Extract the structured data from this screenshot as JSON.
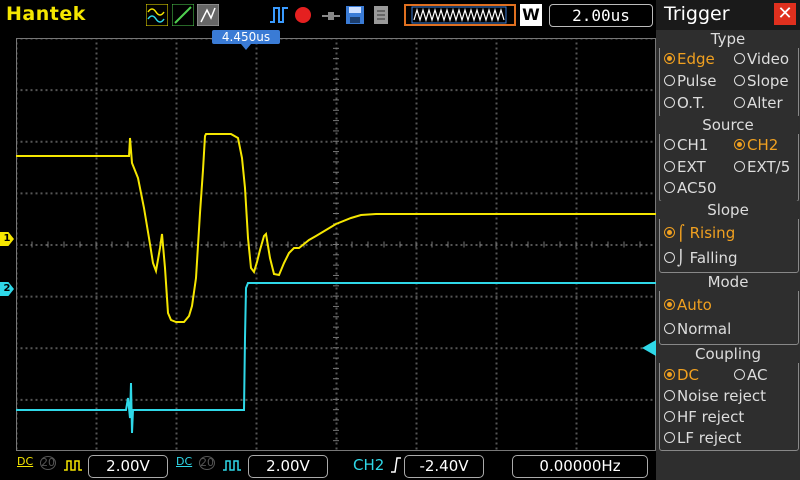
{
  "header": {
    "brand": "Hantek",
    "timebase": "2.00us",
    "trigger_position": "4.450us",
    "mode_letter": "W"
  },
  "icons": {
    "waveform_math": "wave-icon",
    "cursor": "line-icon",
    "run": "pulse-icon",
    "record": "record-icon",
    "save": "save-icon",
    "file": "document-icon"
  },
  "colors": {
    "ch1": "#f5e600",
    "ch2": "#2fd8e8",
    "selected": "#f0a020",
    "trig_pos": "#3a7bd5"
  },
  "trigger_panel": {
    "title": "Trigger",
    "type": {
      "label": "Type",
      "options": [
        "Edge",
        "Video",
        "Pulse",
        "Slope",
        "O.T.",
        "Alter"
      ],
      "selected": "Edge"
    },
    "source": {
      "label": "Source",
      "options": [
        "CH1",
        "CH2",
        "EXT",
        "EXT/5",
        "AC50"
      ],
      "selected": "CH2"
    },
    "slope": {
      "label": "Slope",
      "options": [
        "Rising",
        "Falling"
      ],
      "selected": "Rising"
    },
    "mode": {
      "label": "Mode",
      "options": [
        "Auto",
        "Normal"
      ],
      "selected": "Auto"
    },
    "coupling": {
      "label": "Coupling",
      "options": [
        "DC",
        "AC",
        "Noise reject",
        "HF reject",
        "LF reject"
      ],
      "selected": "DC"
    }
  },
  "markers": {
    "ch1": "1",
    "ch2": "2"
  },
  "status": {
    "ch1_coupling": "DC",
    "ch1_bw": "20",
    "ch1_volts": "2.00V",
    "ch2_coupling": "DC",
    "ch2_bw": "20",
    "ch2_volts": "2.00V",
    "trig_source": "CH2",
    "trig_level": "-2.40V",
    "frequency": "0.00000Hz"
  }
}
